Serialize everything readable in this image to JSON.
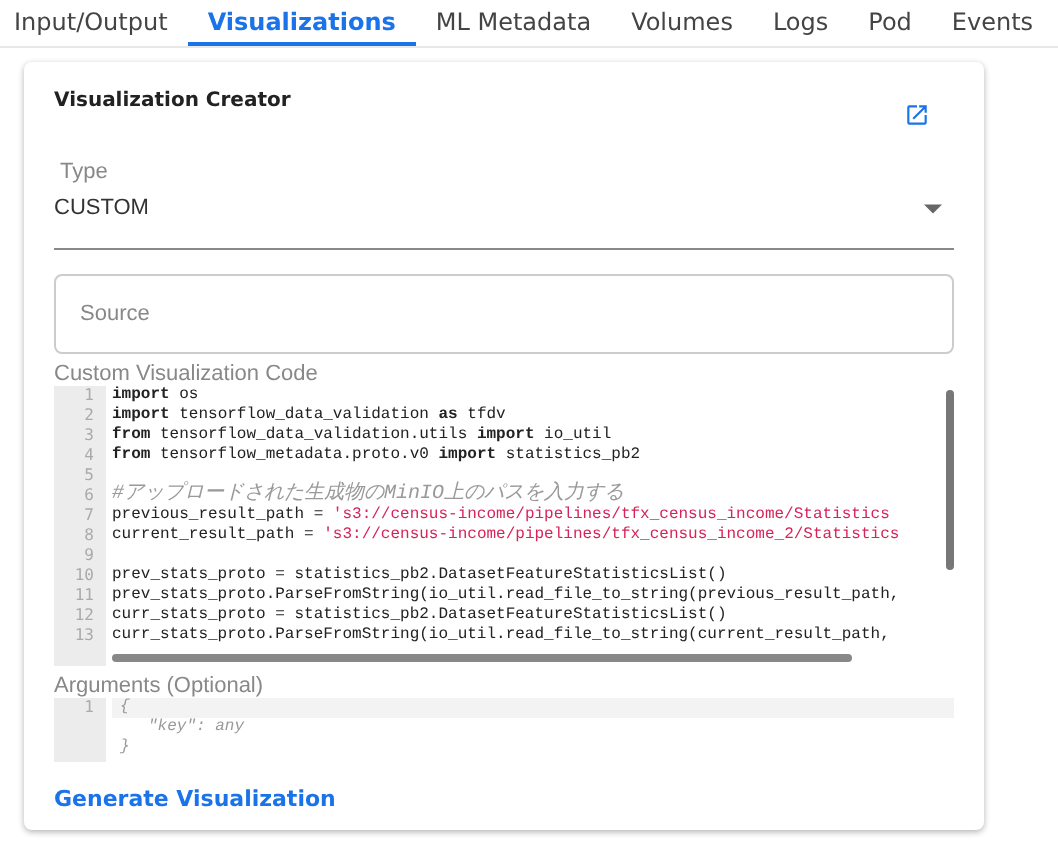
{
  "tabs": [
    {
      "label": "Input/Output",
      "selected": false
    },
    {
      "label": "Visualizations",
      "selected": true
    },
    {
      "label": "ML Metadata",
      "selected": false
    },
    {
      "label": "Volumes",
      "selected": false
    },
    {
      "label": "Logs",
      "selected": false
    },
    {
      "label": "Pod",
      "selected": false
    },
    {
      "label": "Events",
      "selected": false
    }
  ],
  "card": {
    "title": "Visualization Creator",
    "type_field": {
      "label": "Type",
      "value": "CUSTOM"
    },
    "source_field": {
      "placeholder": "Source"
    },
    "code_editor": {
      "label": "Custom Visualization Code",
      "lines": [
        {
          "number": "1",
          "segments": [
            {
              "kind": "kw",
              "text": "import"
            },
            {
              "kind": "plain",
              "text": " os"
            }
          ]
        },
        {
          "number": "2",
          "segments": [
            {
              "kind": "kw",
              "text": "import"
            },
            {
              "kind": "plain",
              "text": " tensorflow_data_validation "
            },
            {
              "kind": "kw",
              "text": "as"
            },
            {
              "kind": "plain",
              "text": " tfdv"
            }
          ]
        },
        {
          "number": "3",
          "segments": [
            {
              "kind": "kw",
              "text": "from"
            },
            {
              "kind": "plain",
              "text": " tensorflow_data_validation.utils "
            },
            {
              "kind": "kw",
              "text": "import"
            },
            {
              "kind": "plain",
              "text": " io_util"
            }
          ]
        },
        {
          "number": "4",
          "segments": [
            {
              "kind": "kw",
              "text": "from"
            },
            {
              "kind": "plain",
              "text": " tensorflow_metadata.proto.v0 "
            },
            {
              "kind": "kw",
              "text": "import"
            },
            {
              "kind": "plain",
              "text": " statistics_pb2"
            }
          ]
        },
        {
          "number": "5"
        },
        {
          "number": "6",
          "segments": [
            {
              "kind": "comment",
              "text": "#アップロードされた生成物のMinIO上のパスを入力する"
            }
          ]
        },
        {
          "number": "7",
          "segments": [
            {
              "kind": "plain",
              "text": "previous_result_path = "
            },
            {
              "kind": "str",
              "text": "'s3://census-income/pipelines/tfx_census_income/Statistics"
            }
          ]
        },
        {
          "number": "8",
          "segments": [
            {
              "kind": "plain",
              "text": "current_result_path = "
            },
            {
              "kind": "str",
              "text": "'s3://census-income/pipelines/tfx_census_income_2/Statistics"
            }
          ]
        },
        {
          "number": "9"
        },
        {
          "number": "10",
          "segments": [
            {
              "kind": "plain",
              "text": "prev_stats_proto = statistics_pb2.DatasetFeatureStatisticsList()"
            }
          ]
        },
        {
          "number": "11",
          "segments": [
            {
              "kind": "plain",
              "text": "prev_stats_proto.ParseFromString(io_util.read_file_to_string(previous_result_path,"
            }
          ]
        },
        {
          "number": "12",
          "segments": [
            {
              "kind": "plain",
              "text": "curr_stats_proto = statistics_pb2.DatasetFeatureStatisticsList()"
            }
          ]
        },
        {
          "number": "13",
          "segments": [
            {
              "kind": "plain",
              "text": "curr_stats_proto.ParseFromString(io_util.read_file_to_string(current_result_path,"
            }
          ]
        }
      ]
    },
    "args_editor": {
      "label": "Arguments (Optional)",
      "lines": [
        {
          "number": "1",
          "text": "{"
        },
        {
          "text": "\"key\": any"
        },
        {
          "text": "}"
        }
      ]
    },
    "generate_button": "Generate Visualization"
  }
}
